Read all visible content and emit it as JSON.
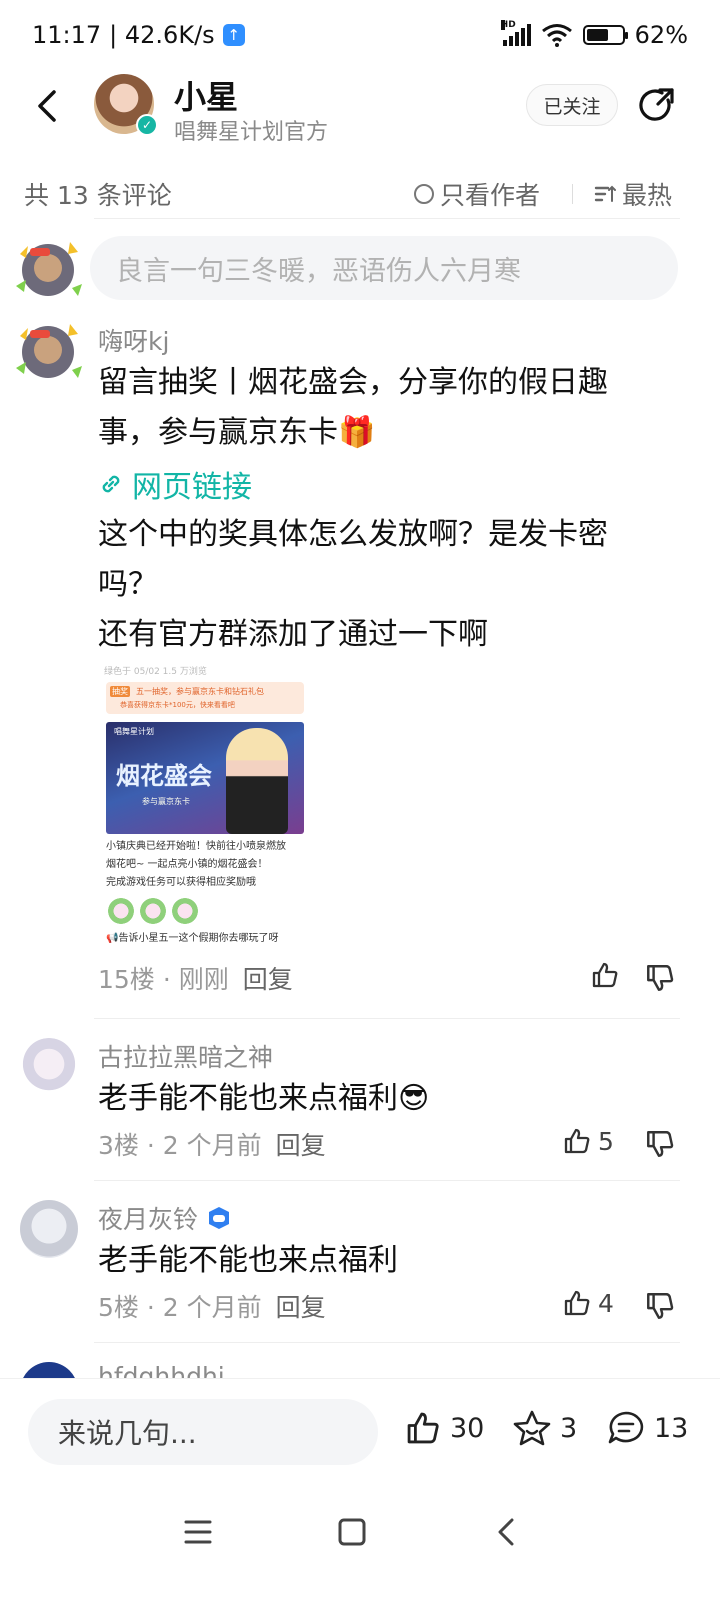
{
  "status_bar": {
    "time": "11:17",
    "speed": "| 42.6K/s",
    "battery_level": 0.62,
    "battery_text": "62%",
    "hd_label": "HD"
  },
  "header": {
    "name": "小星",
    "subtitle": "唱舞星计划官方",
    "follow_label": "已关注"
  },
  "filter": {
    "count_label": "共 13 条评论",
    "author_only_label": "只看作者",
    "sort_label": "最热"
  },
  "input": {
    "placeholder": "良言一句三冬暖，恶语伤人六月寒"
  },
  "comments": [
    {
      "name": "嗨呀kj",
      "text_lines": [
        "留言抽奖丨烟花盛会，分享你的假日趣",
        "事，参与赢京东卡🎁"
      ],
      "link_label": "网页链接",
      "extra_lines": [
        "这个中的奖具体怎么发放啊？是发卡密",
        "吗？",
        "还有官方群添加了通过一下啊"
      ],
      "floor": "15楼",
      "time": "· 刚刚",
      "reply_label": "回复",
      "likes": ""
    },
    {
      "name": "古拉拉黑暗之神",
      "text": "老手能不能也来点福利😎",
      "floor": "3楼",
      "time": "· 2 个月前",
      "reply_label": "回复",
      "likes": "5"
    },
    {
      "name": "夜月灰铃",
      "text": "老手能不能也来点福利",
      "floor": "5楼",
      "time": "· 2 个月前",
      "reply_label": "回复",
      "likes": "4"
    },
    {
      "name": "hfdghhdhj"
    }
  ],
  "embed": {
    "top_text": "绿色于 05/02 1.5 万浏览",
    "tag": "抽奖",
    "banner_title": "五一抽奖，参与赢京东卡和钻石礼包",
    "banner_sub": "恭喜获得京东卡*100元，快来看看吧",
    "logo": "唱舞星计划",
    "art_title": "烟花盛会",
    "art_sub": "参与赢京东卡",
    "lines": [
      "小镇庆典已经开始啦！快前往小喷泉燃放",
      "烟花吧~ 一起点亮小镇的烟花盛会！",
      "完成游戏任务可以获得相应奖励哦"
    ],
    "footer": "📢告诉小星五一这个假期你去哪玩了呀"
  },
  "bottom_bar": {
    "input_placeholder": "来说几句...",
    "likes": "30",
    "favorites": "3",
    "comments": "13"
  },
  "colors": {
    "accent": "#12b5a6",
    "muted": "#999999",
    "input_bg": "#f4f5f7"
  }
}
